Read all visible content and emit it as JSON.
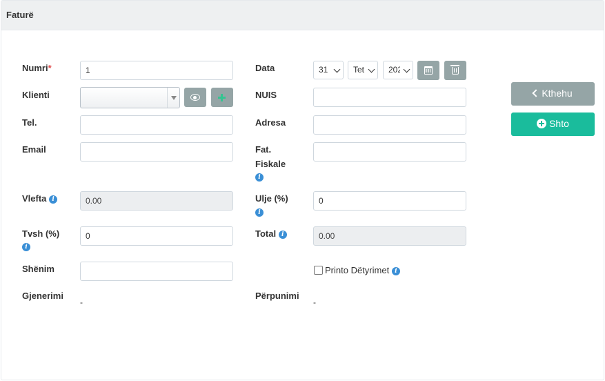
{
  "panel": {
    "title": "Faturë"
  },
  "form": {
    "numri": {
      "label": "Numri",
      "required_mark": "*",
      "value": "1"
    },
    "klienti": {
      "label": "Klienti",
      "value": ""
    },
    "tel": {
      "label": "Tel.",
      "value": ""
    },
    "email": {
      "label": "Email",
      "value": ""
    },
    "vlefta": {
      "label": "Vlefta",
      "value": "0.00"
    },
    "tvsh": {
      "label": "Tvsh (%)",
      "value": "0"
    },
    "shenim": {
      "label": "Shënim",
      "value": ""
    },
    "gjenerimi": {
      "label": "Gjenerimi",
      "value": "-"
    },
    "data": {
      "label": "Data",
      "day": "31",
      "month": "Tet",
      "year": "202"
    },
    "nuis": {
      "label": "NUIS",
      "value": ""
    },
    "adresa": {
      "label": "Adresa",
      "value": ""
    },
    "fat_fiskale": {
      "label_line1": "Fat.",
      "label_line2": "Fiskale",
      "value": ""
    },
    "ulje": {
      "label": "Ulje (%)",
      "value": "0"
    },
    "total": {
      "label": "Total",
      "value": "0.00"
    },
    "printo": {
      "label": "Printo Dëtyrimet",
      "checked": false
    },
    "perpunimi": {
      "label": "Përpunimi",
      "value": "-"
    }
  },
  "actions": {
    "back_label": "Kthehu",
    "add_label": "Shto"
  },
  "icons": {
    "info_glyph": "i",
    "info_color": "#3a8fd6",
    "accent_green": "#1abc9c",
    "muted_gray": "#95a5a6"
  }
}
